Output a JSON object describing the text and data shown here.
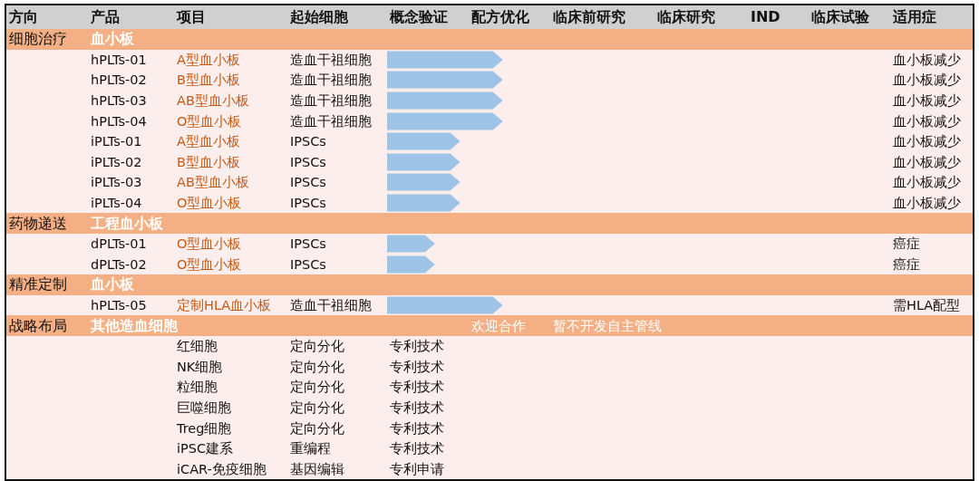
{
  "table": {
    "columns": [
      "方向",
      "产品",
      "项目",
      "起始细胞",
      "概念验证",
      "配方优化",
      "临床前研究",
      "临床研究",
      "IND",
      "临床试验",
      "适用症"
    ],
    "sections": [
      {
        "direction": "细胞治疗",
        "group": "血小板",
        "rows": [
          {
            "kind": "product",
            "product": "hPLTs-01",
            "project": "A型血小板",
            "start_cell": "造血干祖细胞",
            "level": 0.23,
            "indication": "血小板减少"
          },
          {
            "kind": "product",
            "product": "hPLTs-02",
            "project": "B型血小板",
            "start_cell": "造血干祖细胞",
            "level": 0.23,
            "indication": "血小板减少"
          },
          {
            "kind": "product",
            "product": "hPLTs-03",
            "project": "AB型血小板",
            "start_cell": "造血干祖细胞",
            "level": 0.23,
            "indication": "血小板减少"
          },
          {
            "kind": "product",
            "product": "hPLTs-04",
            "project": "O型血小板",
            "start_cell": "造血干祖细胞",
            "level": 0.23,
            "indication": "血小板减少"
          },
          {
            "kind": "product",
            "product": "iPLTs-01",
            "project": "A型血小板",
            "start_cell": "IPSCs",
            "level": 0.145,
            "indication": "血小板减少"
          },
          {
            "kind": "product",
            "product": "iPLTs-02",
            "project": "B型血小板",
            "start_cell": "IPSCs",
            "level": 0.145,
            "indication": "血小板减少"
          },
          {
            "kind": "product",
            "product": "iPLTs-03",
            "project": "AB型血小板",
            "start_cell": "IPSCs",
            "level": 0.145,
            "indication": "血小板减少"
          },
          {
            "kind": "product",
            "product": "iPLTs-04",
            "project": "O型血小板",
            "start_cell": "IPSCs",
            "level": 0.145,
            "indication": "血小板减少"
          }
        ]
      },
      {
        "direction": "药物递送",
        "group": "工程血小板",
        "rows": [
          {
            "kind": "product",
            "product": "dPLTs-01",
            "project": "O型血小板",
            "start_cell": "IPSCs",
            "level": 0.095,
            "indication": "癌症"
          },
          {
            "kind": "product",
            "product": "dPLTs-02",
            "project": "O型血小板",
            "start_cell": "IPSCs",
            "level": 0.095,
            "indication": "癌症"
          }
        ]
      },
      {
        "direction": "精准定制",
        "group": "血小板",
        "rows": [
          {
            "kind": "product",
            "product": "hPLTs-05",
            "project": "定制HLA血小板",
            "start_cell": "造血干祖细胞",
            "level": 0.23,
            "indication": "需HLA配型"
          }
        ]
      },
      {
        "direction": "战略布局",
        "group": "其他造血细胞",
        "notes": [
          "欢迎合作",
          "暂不开发自主管线"
        ],
        "rows": [
          {
            "kind": "platform",
            "project": "红细胞",
            "start_cell": "定向分化",
            "technology": "专利技术"
          },
          {
            "kind": "platform",
            "project": "NK细胞",
            "start_cell": "定向分化",
            "technology": "专利技术"
          },
          {
            "kind": "platform",
            "project": "粒细胞",
            "start_cell": "定向分化",
            "technology": "专利技术"
          },
          {
            "kind": "platform",
            "project": "巨噬细胞",
            "start_cell": "定向分化",
            "technology": "专利技术"
          },
          {
            "kind": "platform",
            "project": "Treg细胞",
            "start_cell": "定向分化",
            "technology": "专利技术"
          },
          {
            "kind": "platform",
            "project": "iPSC建系",
            "start_cell": "重编程",
            "technology": "专利技术"
          },
          {
            "kind": "platform",
            "project": "iCAR-免疫细胞",
            "start_cell": "基因编辑",
            "technology": "专利申请"
          }
        ]
      }
    ]
  }
}
